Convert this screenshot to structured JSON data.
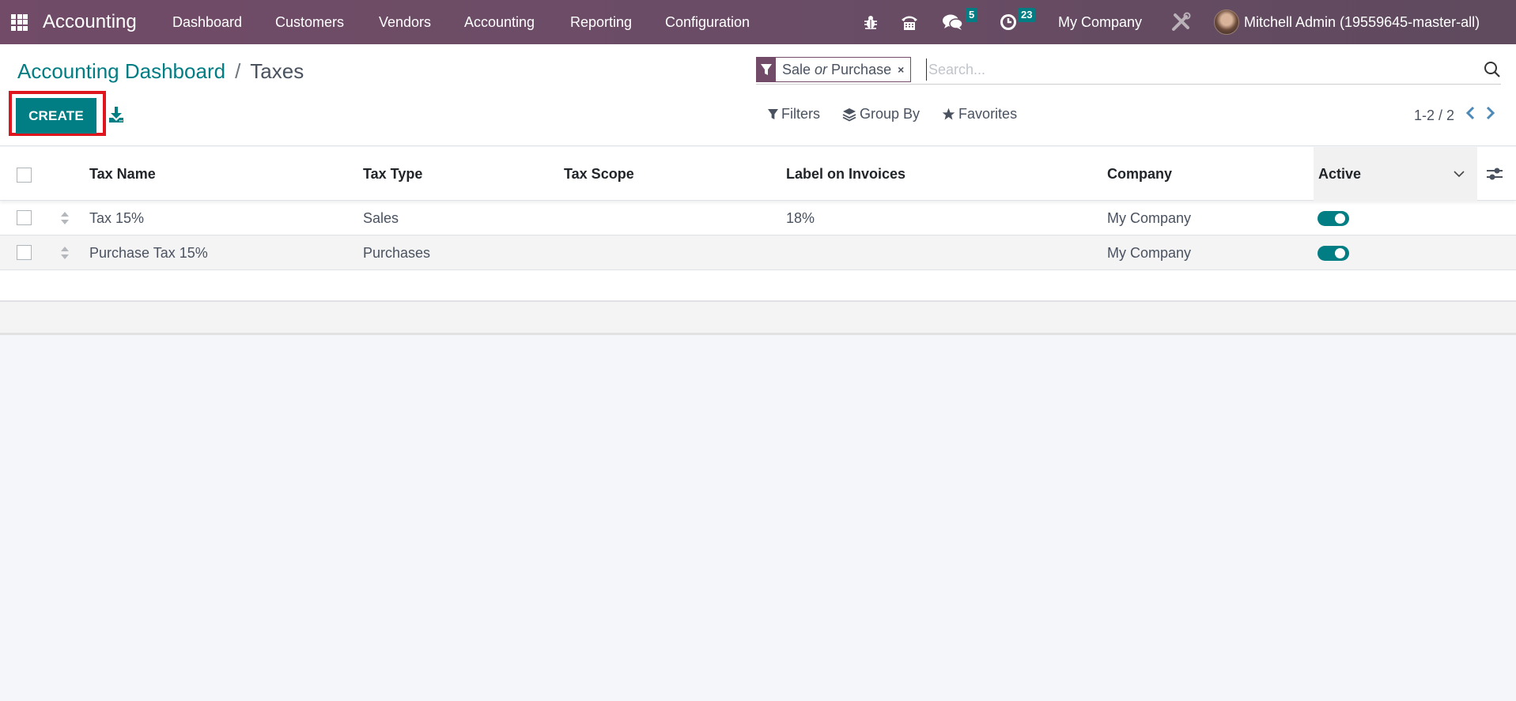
{
  "navbar": {
    "app_name": "Accounting",
    "menu": [
      "Dashboard",
      "Customers",
      "Vendors",
      "Accounting",
      "Reporting",
      "Configuration"
    ],
    "icons": {
      "apps": "apps-grid-icon",
      "debug": "bug-icon",
      "voip": "phone-icon",
      "messages": "chat-icon",
      "activities": "clock-icon",
      "settings": "tools-icon"
    },
    "messages_count": "5",
    "activities_count": "23",
    "company": "My Company",
    "user": "Mitchell Admin (19559645-master-all)"
  },
  "breadcrumb": {
    "parent": "Accounting Dashboard",
    "separator": "/",
    "current": "Taxes"
  },
  "toolbar": {
    "create_label": "CREATE",
    "download_icon": "download-icon"
  },
  "search": {
    "facet": {
      "icon": "filter-icon",
      "value_1": "Sale",
      "joiner": "or",
      "value_2": "Purchase",
      "remove": "×"
    },
    "placeholder": "Search...",
    "value": ""
  },
  "filters": {
    "filters_label": "Filters",
    "group_by_label": "Group By",
    "favorites_label": "Favorites"
  },
  "pager": {
    "value": "1-2 / 2",
    "prev": "‹",
    "next": "›"
  },
  "table": {
    "columns": [
      "Tax Name",
      "Tax Type",
      "Tax Scope",
      "Label on Invoices",
      "Company",
      "Active"
    ],
    "rows": [
      {
        "tax_name": "Tax 15%",
        "tax_type": "Sales",
        "tax_scope": "",
        "label_on_invoices": "18%",
        "company": "My Company",
        "active": true
      },
      {
        "tax_name": "Purchase Tax 15%",
        "tax_type": "Purchases",
        "tax_scope": "",
        "label_on_invoices": "",
        "company": "My Company",
        "active": true
      }
    ]
  },
  "colors": {
    "brand": "#714b67",
    "accent": "#017e84",
    "highlight_box": "#e0161f"
  }
}
